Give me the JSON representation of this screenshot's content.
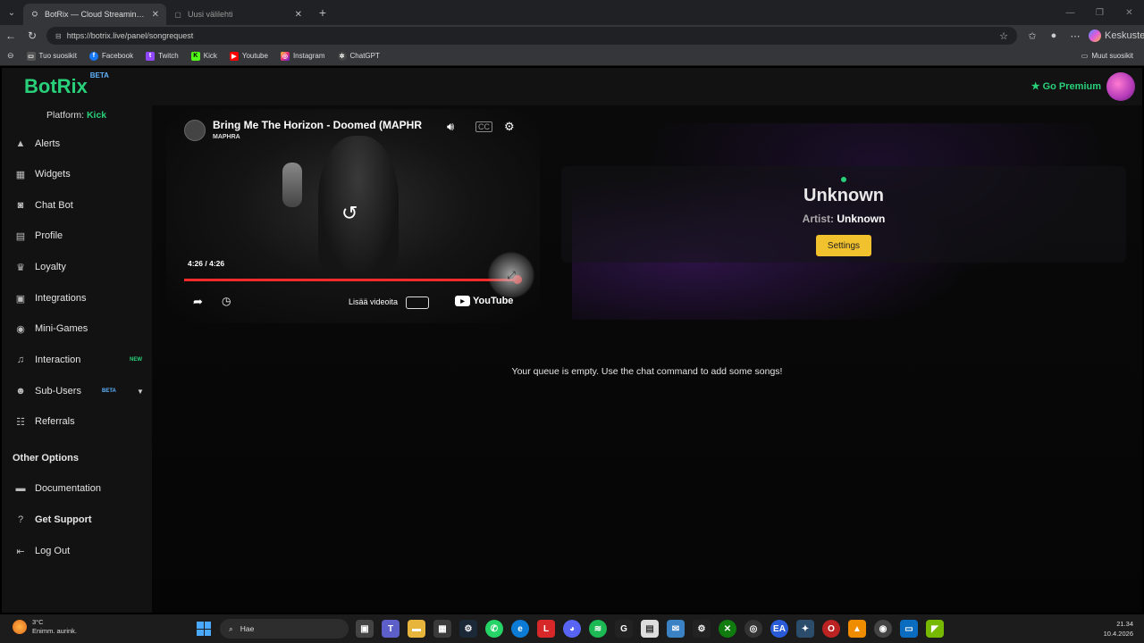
{
  "browser": {
    "tabs": [
      {
        "title": "BotRix — Cloud Streaming Bot for"
      },
      {
        "title": "Uusi välilehti"
      }
    ],
    "url": "https://botrix.live/panel/songrequest",
    "copilot_label": "Keskustelu",
    "bookmarks": [
      {
        "label": "Tuo suosikit",
        "icon": "import-icon"
      },
      {
        "label": "Facebook",
        "icon": "facebook-icon"
      },
      {
        "label": "Twitch",
        "icon": "twitch-icon"
      },
      {
        "label": "Kick",
        "icon": "kick-icon"
      },
      {
        "label": "Youtube",
        "icon": "youtube-icon"
      },
      {
        "label": "Instagram",
        "icon": "instagram-icon"
      },
      {
        "label": "ChatGPT",
        "icon": "chatgpt-icon"
      }
    ],
    "other_bookmarks": "Muut suosikit"
  },
  "header": {
    "logo": "BotRix",
    "logo_badge": "BETA",
    "premium_label": "Go Premium"
  },
  "sidebar": {
    "platform_label": "Platform:",
    "platform_value": "Kick",
    "items": [
      {
        "label": "Alerts",
        "icon": "warning-icon"
      },
      {
        "label": "Widgets",
        "icon": "grid-icon"
      },
      {
        "label": "Chat Bot",
        "icon": "robot-icon"
      },
      {
        "label": "Profile",
        "icon": "profile-icon"
      },
      {
        "label": "Loyalty",
        "icon": "trophy-icon"
      },
      {
        "label": "Integrations",
        "icon": "integrations-icon"
      },
      {
        "label": "Mini-Games",
        "icon": "gamepad-icon"
      },
      {
        "label": "Interaction",
        "icon": "music-icon",
        "badge": "NEW"
      },
      {
        "label": "Sub-Users",
        "icon": "users-icon",
        "badge": "BETA"
      },
      {
        "label": "Referrals",
        "icon": "referrals-icon"
      }
    ],
    "other_options_heading": "Other Options",
    "other_items": [
      {
        "label": "Documentation",
        "icon": "book-icon"
      },
      {
        "label": "Get Support",
        "icon": "help-icon"
      },
      {
        "label": "Log Out",
        "icon": "logout-icon"
      }
    ]
  },
  "player": {
    "title": "Bring Me The Horizon - Doomed (MAPHR",
    "channel": "MAPHRA",
    "time": "4:26 / 4:26",
    "more_videos": "Lisää videoita",
    "youtube_label": "YouTube",
    "progress": 1.0
  },
  "now_playing": {
    "title": "Unknown",
    "artist_label": "Artist:",
    "artist_value": "Unknown",
    "settings_label": "Settings"
  },
  "queue": {
    "empty_message": "Your queue is empty. Use the chat command to add some songs!"
  },
  "taskbar": {
    "temperature": "3°C",
    "weather": "Enimm. aurink.",
    "search_placeholder": "Hae",
    "time": "21.34",
    "date": "10.4.2026"
  },
  "colors": {
    "brand_green": "#29d07a",
    "settings_yellow": "#f2c12e",
    "progress_red": "#ff2a2a"
  }
}
